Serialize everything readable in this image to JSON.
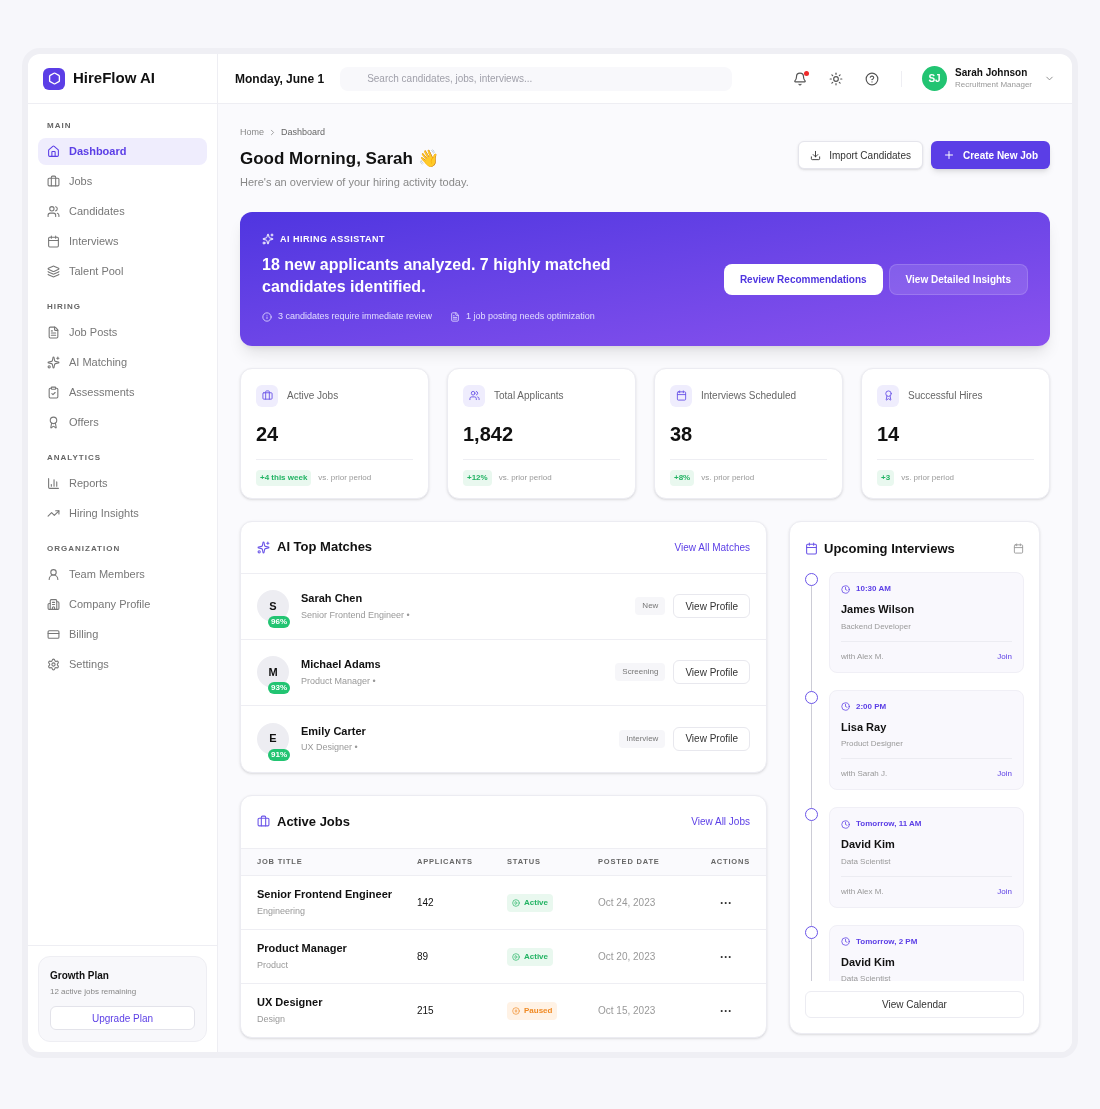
{
  "brand": {
    "name": "HireFlow AI"
  },
  "header": {
    "date": "Monday, June 1",
    "search_placeholder": "Search candidates, jobs, interviews...",
    "notifications_unread": true,
    "user": {
      "initials": "SJ",
      "name": "Sarah Johnson",
      "role": "Recruitment Manager"
    }
  },
  "sidebar": {
    "sections": [
      {
        "title": "MAIN",
        "items": [
          {
            "label": "Dashboard",
            "selected": true
          },
          {
            "label": "Jobs",
            "selected": false
          },
          {
            "label": "Candidates",
            "selected": false
          },
          {
            "label": "Interviews",
            "selected": false
          },
          {
            "label": "Talent Pool",
            "selected": false
          }
        ]
      },
      {
        "title": "HIRING",
        "items": [
          {
            "label": "Job Posts",
            "selected": false
          },
          {
            "label": "AI Matching",
            "selected": false
          },
          {
            "label": "Assessments",
            "selected": false
          },
          {
            "label": "Offers",
            "selected": false
          }
        ]
      },
      {
        "title": "ANALYTICS",
        "items": [
          {
            "label": "Reports",
            "selected": false
          },
          {
            "label": "Hiring Insights",
            "selected": false
          }
        ]
      },
      {
        "title": "ORGANIZATION",
        "items": [
          {
            "label": "Team Members",
            "selected": false
          },
          {
            "label": "Company Profile",
            "selected": false
          },
          {
            "label": "Billing",
            "selected": false
          },
          {
            "label": "Settings",
            "selected": false
          }
        ]
      }
    ],
    "plan": {
      "title": "Growth Plan",
      "note": "12 active jobs remaining",
      "button": "Upgrade Plan"
    }
  },
  "page": {
    "breadcrumb": [
      "Home",
      "Dashboard"
    ],
    "title": "Good Morning, Sarah 👋",
    "subtitle": "Here's an overview of your hiring activity today.",
    "buttons": [
      {
        "label": "Import Candidates",
        "kind": "secondary"
      },
      {
        "label": "Create New Job",
        "kind": "primary"
      }
    ]
  },
  "assistant": {
    "eyebrow": "AI HIRING ASSISTANT",
    "headline": "18 new applicants analyzed. 7 highly matched candidates identified.",
    "notes": [
      "3 candidates require immediate review",
      "1 job posting needs optimization"
    ],
    "buttons": [
      {
        "label": "Review Recommendations",
        "kind": "primary"
      },
      {
        "label": "View Detailed Insights",
        "kind": "secondary"
      }
    ]
  },
  "stats": [
    {
      "label": "Active Jobs",
      "value": "24",
      "delta": "+4 this week",
      "note": "vs. prior period"
    },
    {
      "label": "Total Applicants",
      "value": "1,842",
      "delta": "+12%",
      "note": "vs. prior period"
    },
    {
      "label": "Interviews Scheduled",
      "value": "38",
      "delta": "+8%",
      "note": "vs. prior period"
    },
    {
      "label": "Successful Hires",
      "value": "14",
      "delta": "+3",
      "note": "vs. prior period"
    }
  ],
  "top_matches": {
    "title": "AI Top Matches",
    "link": "View All Matches",
    "items": [
      {
        "initial": "S",
        "score": "96%",
        "name": "Sarah Chen",
        "role": "Senior Frontend Engineer •",
        "status": "New",
        "button": "View Profile"
      },
      {
        "initial": "M",
        "score": "93%",
        "name": "Michael Adams",
        "role": "Product Manager •",
        "status": "Screening",
        "button": "View Profile"
      },
      {
        "initial": "E",
        "score": "91%",
        "name": "Emily Carter",
        "role": "UX Designer •",
        "status": "Interview",
        "button": "View Profile"
      }
    ]
  },
  "active_jobs": {
    "title": "Active Jobs",
    "link": "View All Jobs",
    "columns": [
      "JOB TITLE",
      "APPLICANTS",
      "STATUS",
      "POSTED DATE",
      "ACTIONS"
    ],
    "rows": [
      {
        "title": "Senior Frontend Engineer",
        "department": "Engineering",
        "applicants": "142",
        "status": "Active",
        "kind": "active",
        "posted": "Oct 24, 2023",
        "actions": "···"
      },
      {
        "title": "Product Manager",
        "department": "Product",
        "applicants": "89",
        "status": "Active",
        "kind": "active",
        "posted": "Oct 20, 2023",
        "actions": "···"
      },
      {
        "title": "UX Designer",
        "department": "Design",
        "applicants": "215",
        "status": "Paused",
        "kind": "paused",
        "posted": "Oct 15, 2023",
        "actions": "···"
      }
    ]
  },
  "interviews": {
    "title": "Upcoming Interviews",
    "items": [
      {
        "time": "10:30 AM",
        "name": "James Wilson",
        "role": "Backend Developer",
        "with": "with Alex M.",
        "action": "Join"
      },
      {
        "time": "2:00 PM",
        "name": "Lisa Ray",
        "role": "Product Designer",
        "with": "with Sarah J.",
        "action": "Join"
      },
      {
        "time": "Tomorrow, 11 AM",
        "name": "David Kim",
        "role": "Data Scientist",
        "with": "with Alex M.",
        "action": "Join"
      },
      {
        "time": "Tomorrow, 2 PM",
        "name": "David Kim",
        "role": "Data Scientist"
      }
    ],
    "button": "View Calendar"
  }
}
